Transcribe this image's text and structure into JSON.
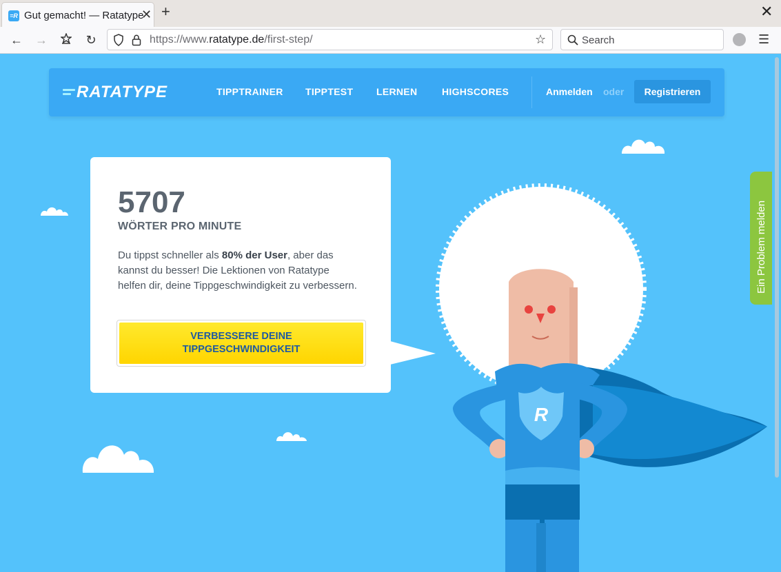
{
  "browser": {
    "tab_title": "Gut gemacht! — Ratatype",
    "url_prefix": "https://www.",
    "url_domain": "ratatype.de",
    "url_path": "/first-step/",
    "search_placeholder": "Search"
  },
  "header": {
    "logo_text": "RATATYPE",
    "nav": [
      "TIPPTRAINER",
      "TIPPTEST",
      "LERNEN",
      "HIGHSCORES"
    ],
    "login": "Anmelden",
    "or": "oder",
    "register": "Registrieren"
  },
  "result": {
    "wpm": "5707",
    "wpm_label": "WÖRTER PRO MINUTE",
    "desc_before": "Du tippst schneller als ",
    "desc_bold": "80% der User",
    "desc_after": ", aber das kannst du besser! Die Lektionen von Ratatype helfen dir, deine Tippgeschwindigkeit zu verbessern.",
    "cta": "VERBESSERE DEINE TIPPGESCHWINDIGKEIT"
  },
  "feedback_tab": "Ein Problem melden",
  "hero_badge": "R",
  "colors": {
    "page_bg": "#54c2fb",
    "header_bg": "#3aa9f4",
    "cta_yellow": "#ffe000",
    "feedback_green": "#8cc63f"
  }
}
